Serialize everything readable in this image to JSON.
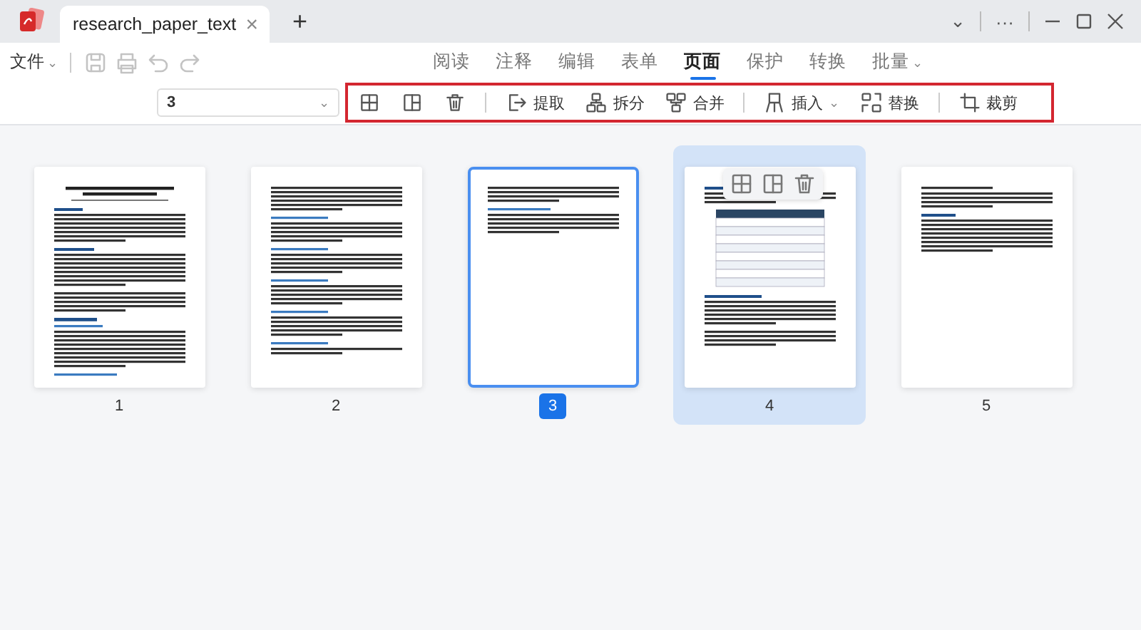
{
  "document_tab": {
    "title": "research_paper_text",
    "close": "×"
  },
  "new_tab": "+",
  "window_controls": {
    "dropdown": "⌄",
    "more": "···"
  },
  "file_menu": {
    "label": "文件",
    "caret": "⌄"
  },
  "nav_tabs": [
    {
      "label": "阅读",
      "selected": false
    },
    {
      "label": "注释",
      "selected": false
    },
    {
      "label": "编辑",
      "selected": false
    },
    {
      "label": "表单",
      "selected": false
    },
    {
      "label": "页面",
      "selected": true
    },
    {
      "label": "保护",
      "selected": false
    },
    {
      "label": "转换",
      "selected": false
    },
    {
      "label": "批量",
      "selected": false,
      "caret": "⌄"
    }
  ],
  "page_select": {
    "value": "3",
    "caret": "⌄"
  },
  "toolbar": [
    {
      "kind": "button"
    },
    {
      "kind": "button"
    },
    {
      "kind": "button"
    },
    {
      "kind": "separator"
    },
    {
      "kind": "button",
      "label": "提取"
    },
    {
      "kind": "button",
      "label": "拆分"
    },
    {
      "kind": "button",
      "label": "合并"
    },
    {
      "kind": "separator"
    },
    {
      "kind": "button",
      "label": "插入",
      "caret": "⌄"
    },
    {
      "kind": "button",
      "label": "替换"
    },
    {
      "kind": "separator"
    },
    {
      "kind": "button",
      "label": "裁剪"
    }
  ],
  "pages": [
    {
      "number": "1",
      "selected": false,
      "hovered": false
    },
    {
      "number": "2",
      "selected": false,
      "hovered": false
    },
    {
      "number": "3",
      "selected": true,
      "hovered": false
    },
    {
      "number": "4",
      "selected": false,
      "hovered": true
    },
    {
      "number": "5",
      "selected": false,
      "hovered": false
    }
  ]
}
